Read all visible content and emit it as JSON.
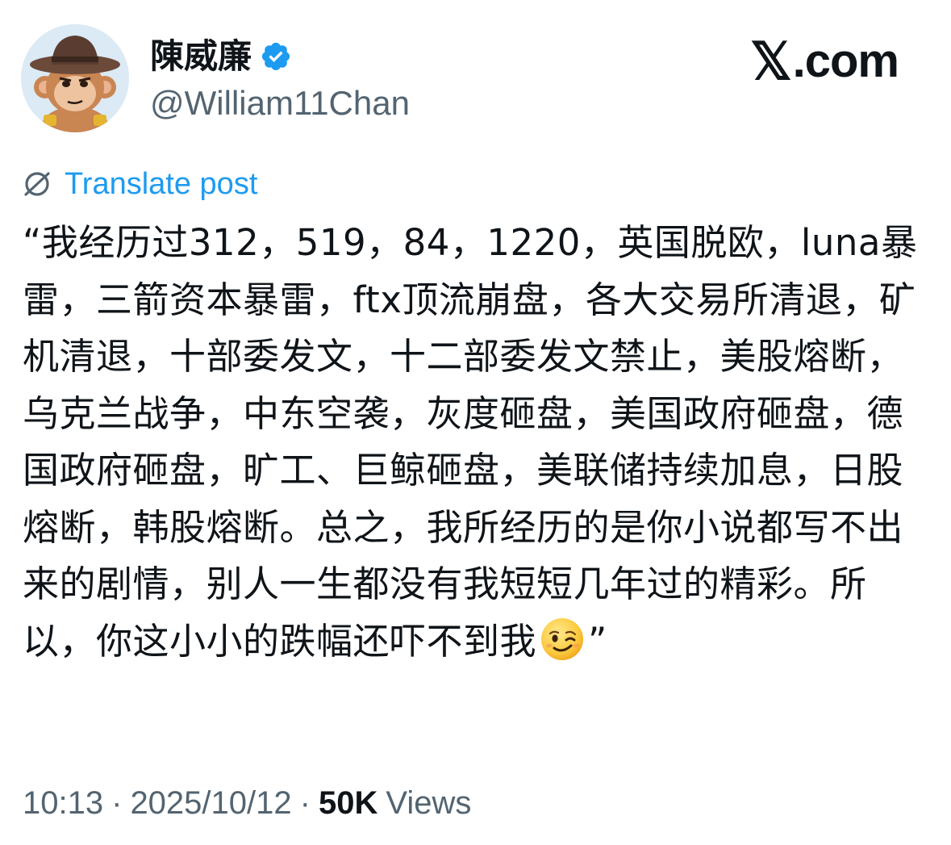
{
  "author": {
    "display_name": "陳威廉",
    "handle": "@William11Chan",
    "verified_icon": "verified-badge-icon",
    "avatar_icon": "monkey-cowboy-hat-avatar"
  },
  "site": {
    "logo_mark": "𝕏",
    "logo_text": ".com"
  },
  "translate": {
    "label": "Translate post",
    "icon": "translate-globe-icon"
  },
  "post": {
    "text": "“我经历过312，519，84，1220，英国脱欧，luna暴雷，三箭资本暴雷，ftx顶流崩盘，各大交易所清退，矿机清退，十部委发文，十二部委发文禁止，美股熔断，乌克兰战争，中东空袭，灰度砸盘，美国政府砸盘，德国政府砸盘，旷工、巨鲸砸盘，美联储持续加息，日股熔断，韩股熔断。总之，我所经历的是你小说都写不出来的剧情，别人一生都没有我短短几年过的精彩。所以，你这小小的跌幅还吓不到我",
    "emoji": "winking-face-emoji",
    "closing_quote": "”"
  },
  "meta": {
    "time": "10:13",
    "separator": "·",
    "date": "2025/10/12",
    "views_count": "50K",
    "views_label": "Views"
  },
  "colors": {
    "text_primary": "#0f1419",
    "text_secondary": "#536471",
    "accent": "#1d9bf0"
  }
}
